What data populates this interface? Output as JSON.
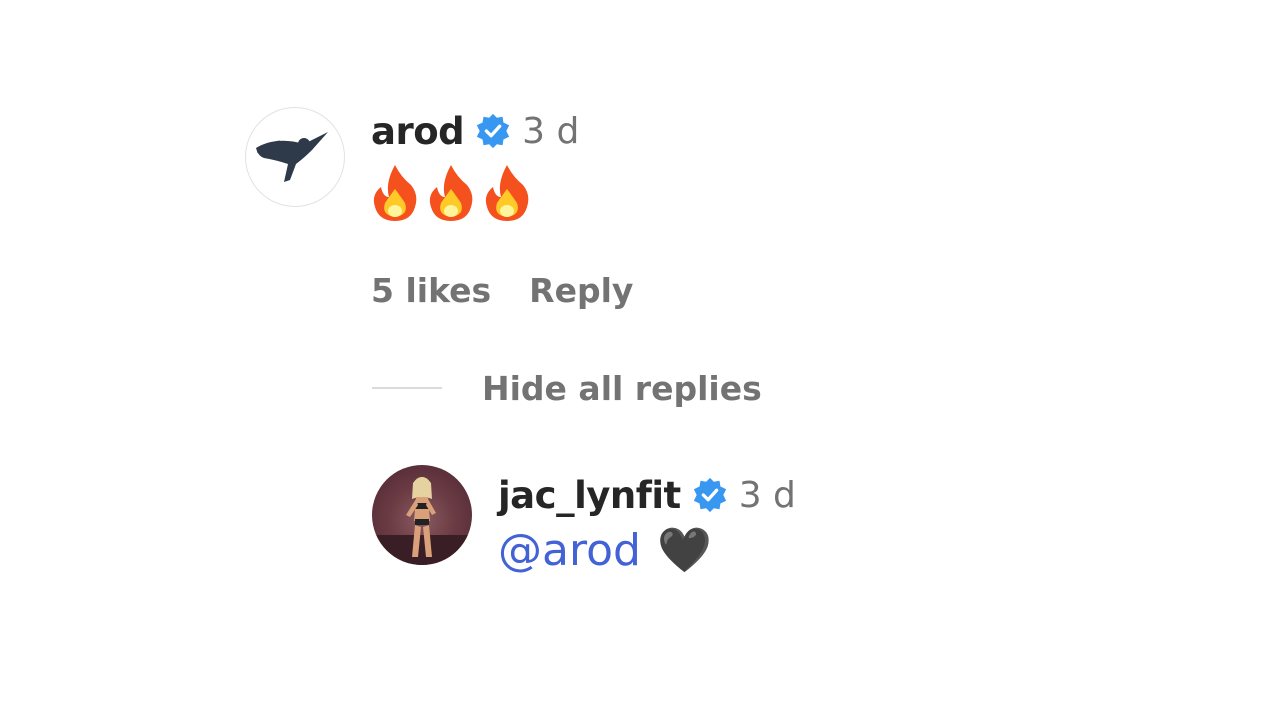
{
  "comment": {
    "username": "arod",
    "time": "3 d",
    "text": "🔥🔥🔥",
    "likes": "5 likes",
    "reply_label": "Reply"
  },
  "replies_toggle": {
    "label": "Hide all replies"
  },
  "reply": {
    "username": "jac_lynfit",
    "time": "3 d",
    "mention": "@arod",
    "emoji": "🖤"
  },
  "colors": {
    "verified_badge": "#3897f0",
    "mention": "#4262d6",
    "muted_text": "#737373"
  },
  "icons": {
    "verified": "verified-badge-icon",
    "fire": "fire-emoji-icon",
    "heart": "black-heart-emoji"
  }
}
